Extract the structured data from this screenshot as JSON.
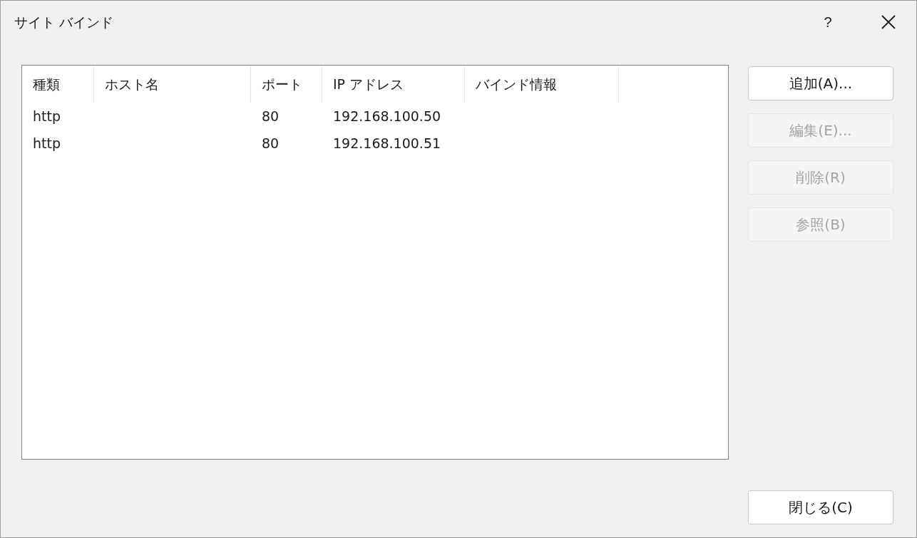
{
  "window": {
    "title": "サイト バインド",
    "help": "?"
  },
  "table": {
    "columns": [
      "種類",
      "ホスト名",
      "ポート",
      "IP アドレス",
      "バインド情報"
    ],
    "rows": [
      {
        "type": "http",
        "port": "80",
        "ip_address": "192.168.100.50",
        "selected": false
      },
      {
        "type": "http",
        "port": "80",
        "ip_address": "192.168.100.51",
        "selected": false
      }
    ]
  },
  "buttons": [
    {
      "label": "追加(A)...",
      "disabled": false
    },
    {
      "label": "編集(E)...",
      "disabled": true
    },
    {
      "label": "削除(R)",
      "disabled": true
    },
    {
      "label": "参照(B)",
      "disabled": true
    }
  ],
  "close_button": {
    "label": "閉じる(C)",
    "disabled": false
  }
}
